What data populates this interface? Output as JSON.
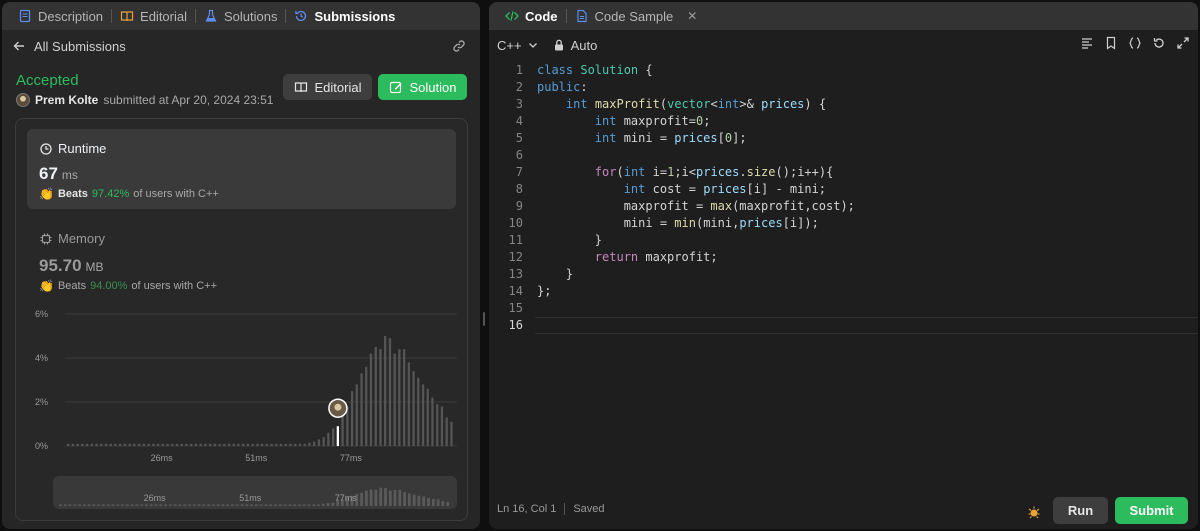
{
  "left_tabs": [
    {
      "label": "Description",
      "icon": "description-icon"
    },
    {
      "label": "Editorial",
      "icon": "book-icon"
    },
    {
      "label": "Solutions",
      "icon": "flask-icon"
    },
    {
      "label": "Submissions",
      "icon": "history-icon"
    }
  ],
  "subheader": {
    "back_label": "All Submissions"
  },
  "result": {
    "status": "Accepted",
    "user": "Prem Kolte",
    "submitted_text": "submitted at Apr 20, 2024 23:51"
  },
  "buttons": {
    "editorial": "Editorial",
    "solution": "Solution"
  },
  "runtime": {
    "title": "Runtime",
    "value": "67",
    "unit": "ms",
    "beats_label": "Beats",
    "beats_pct": "97.42%",
    "beats_suffix": "of users with C++"
  },
  "memory": {
    "title": "Memory",
    "value": "95.70",
    "unit": "MB",
    "beats_label": "Beats",
    "beats_pct": "94.00%",
    "beats_suffix": "of users with C++"
  },
  "chart_data": {
    "type": "bar",
    "title": "",
    "ylabel": "",
    "xlabel": "",
    "ylim": [
      0,
      6
    ],
    "yticks": [
      "0%",
      "2%",
      "4%",
      "6%"
    ],
    "xtick_labels": [
      "26ms",
      "51ms",
      "77ms"
    ],
    "highlight_label": "67ms",
    "values": [
      0.1,
      0.1,
      0.1,
      0.1,
      0.1,
      0.1,
      0.1,
      0.1,
      0.1,
      0.1,
      0.1,
      0.1,
      0.1,
      0.1,
      0.1,
      0.1,
      0.1,
      0.1,
      0.1,
      0.1,
      0.1,
      0.1,
      0.1,
      0.1,
      0.1,
      0.1,
      0.1,
      0.1,
      0.1,
      0.1,
      0.1,
      0.1,
      0.1,
      0.1,
      0.1,
      0.1,
      0.1,
      0.1,
      0.1,
      0.1,
      0.1,
      0.1,
      0.1,
      0.1,
      0.1,
      0.1,
      0.1,
      0.1,
      0.1,
      0.1,
      0.1,
      0.15,
      0.2,
      0.3,
      0.4,
      0.6,
      0.8,
      0.9,
      1.8,
      1.8,
      2.5,
      2.8,
      3.3,
      3.6,
      4.2,
      4.5,
      4.4,
      5.0,
      4.9,
      4.2,
      4.4,
      4.4,
      3.8,
      3.4,
      3.1,
      2.8,
      2.6,
      2.2,
      1.9,
      1.8,
      1.3,
      1.1
    ],
    "highlight_index": 57
  },
  "right_tabs": [
    {
      "label": "Code",
      "icon": "code-icon"
    },
    {
      "label": "Code Sample",
      "icon": "file-icon"
    }
  ],
  "editor_toolbar": {
    "language": "C++",
    "lock_label": "Auto"
  },
  "code_lines": [
    "class Solution {",
    "public:",
    "    int maxProfit(vector<int>& prices) {",
    "        int maxprofit=0;",
    "        int mini = prices[0];",
    "",
    "        for(int i=1;i<prices.size();i++){",
    "            int cost = prices[i] - mini;",
    "            maxprofit = max(maxprofit,cost);",
    "            mini = min(mini,prices[i]);",
    "        }",
    "        return maxprofit;",
    "    }",
    "};",
    "",
    ""
  ],
  "status": {
    "position": "Ln 16, Col 1",
    "saved": "Saved",
    "run": "Run",
    "submit": "Submit"
  }
}
